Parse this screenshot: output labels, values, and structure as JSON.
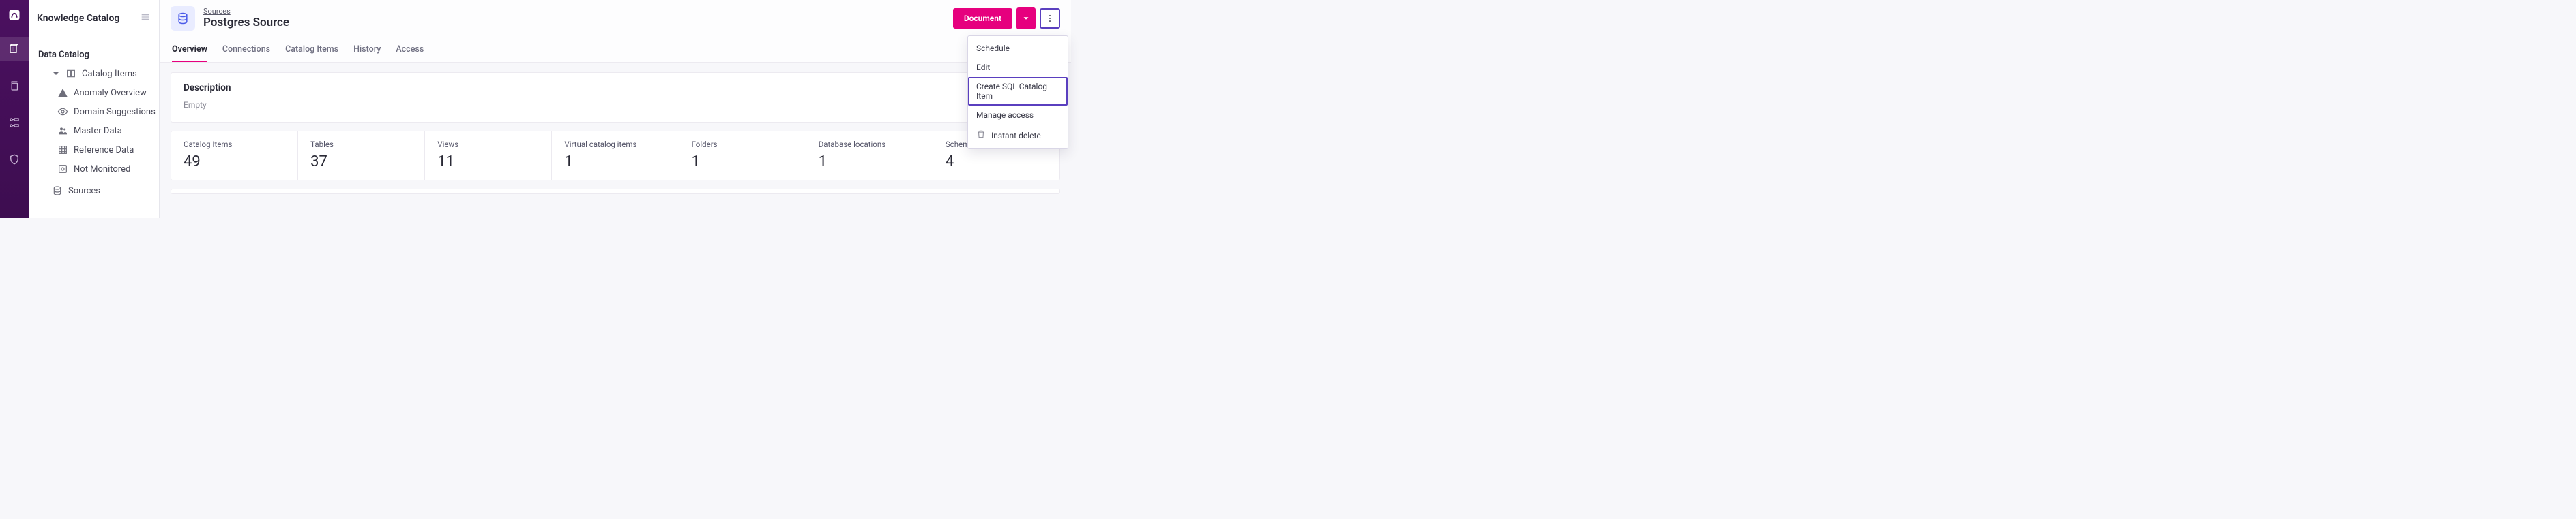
{
  "app": {
    "name": "Knowledge Catalog"
  },
  "sidebar": {
    "section": "Data Catalog",
    "group": "Catalog Items",
    "items": [
      {
        "label": "Anomaly Overview"
      },
      {
        "label": "Domain Suggestions"
      },
      {
        "label": "Master Data"
      },
      {
        "label": "Reference Data"
      },
      {
        "label": "Not Monitored"
      }
    ],
    "sources": "Sources"
  },
  "header": {
    "breadcrumb": "Sources",
    "title": "Postgres Source",
    "primary_button": "Document"
  },
  "tabs": [
    {
      "label": "Overview",
      "active": true
    },
    {
      "label": "Connections"
    },
    {
      "label": "Catalog Items"
    },
    {
      "label": "History"
    },
    {
      "label": "Access"
    }
  ],
  "description": {
    "title": "Description",
    "value": "Empty"
  },
  "stats": [
    {
      "label": "Catalog Items",
      "value": "49"
    },
    {
      "label": "Tables",
      "value": "37"
    },
    {
      "label": "Views",
      "value": "11"
    },
    {
      "label": "Virtual catalog items",
      "value": "1"
    },
    {
      "label": "Folders",
      "value": "1"
    },
    {
      "label": "Database locations",
      "value": "1"
    },
    {
      "label": "Schema locations",
      "value": "4"
    }
  ],
  "menu": {
    "items": [
      {
        "label": "Schedule"
      },
      {
        "label": "Edit"
      },
      {
        "label": "Create SQL Catalog Item",
        "highlight": true
      },
      {
        "label": "Manage access"
      },
      {
        "label": "Instant delete",
        "icon": "trash"
      }
    ]
  }
}
